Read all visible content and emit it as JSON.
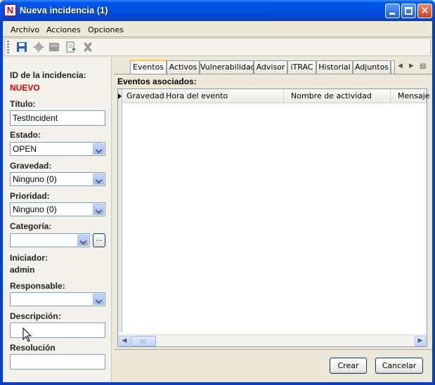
{
  "window": {
    "title": "Nueva incidencia (1)",
    "app_icon_letter": "N",
    "close_glyph": "✕"
  },
  "menu": [
    "Archivo",
    "Acciones",
    "Opciones"
  ],
  "toolbar": {
    "icons": [
      "save-icon",
      "gear-icon",
      "disk-icon",
      "document-export-icon",
      "delete-icon"
    ]
  },
  "incident": {
    "id_label": "ID de la incidencia:",
    "id_value": "NUEVO",
    "title_label": "Título:",
    "title_value": "TestIncident",
    "state_label": "Estado:",
    "state_value": "OPEN",
    "severity_label": "Gravedad:",
    "severity_value": "Ninguno (0)",
    "priority_label": "Prioridad:",
    "priority_value": "Ninguno (0)",
    "category_label": "Categoría:",
    "category_value": "",
    "category_button": "...",
    "initiator_label": "Iniciador:",
    "initiator_value": "admin",
    "owner_label": "Responsable:",
    "owner_value": "",
    "description_label": "Descripción:",
    "description_value": "",
    "resolution_label": "Resolución",
    "resolution_value": ""
  },
  "tabs": [
    "Eventos",
    "Activos",
    "Vulnerabilidad",
    "Advisor",
    "iTRAC",
    "Historial",
    "Adjuntos"
  ],
  "active_tab": "Eventos",
  "events": {
    "section_title": "Eventos asociados:",
    "columns": [
      "Gravedad",
      "Hora del evento",
      "Nombre de actividad",
      "Mensaje"
    ],
    "rows": []
  },
  "buttons": {
    "create": "Crear",
    "cancel": "Cancelar"
  },
  "colors": {
    "titlebar": "#0054e3",
    "id_value": "#e00000",
    "active_tab_accent": "#ffc83c"
  }
}
